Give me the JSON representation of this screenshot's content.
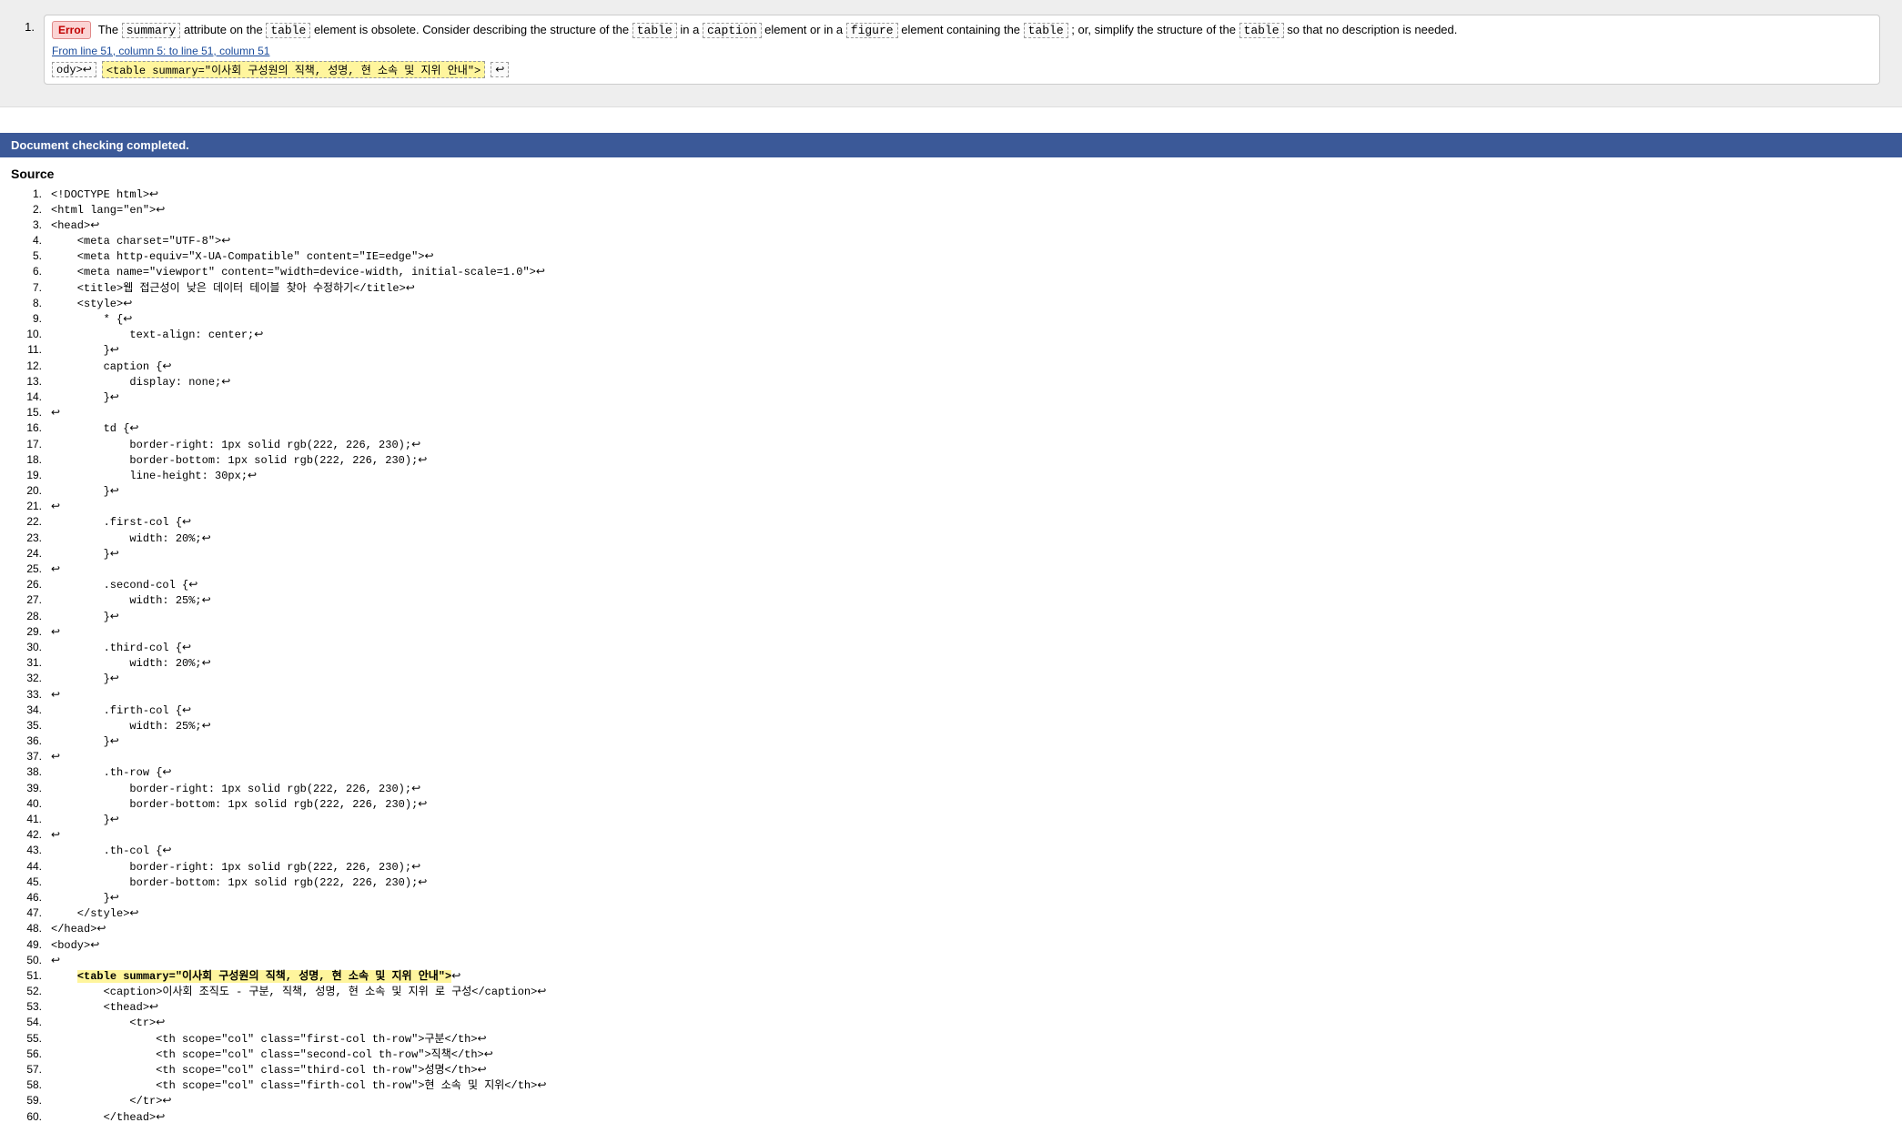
{
  "error": {
    "number": "1.",
    "badge": "Error",
    "msg_prefix": "The ",
    "code1": "summary",
    "msg_mid1": " attribute on the ",
    "code2": "table",
    "msg_mid2": " element is obsolete. Consider describing the structure of the ",
    "code3": "table",
    "msg_mid3": " in a ",
    "code4": "caption",
    "msg_mid4": " element or in a ",
    "code5": "figure",
    "msg_mid5": " element containing the ",
    "code6": "table",
    "msg_mid6": "; or, simplify the structure of the ",
    "code7": "table",
    "msg_suffix": " so that no description is needed.",
    "location_link": "From line 51, column 5: to line 51, column 51",
    "snippet_left": "ody>↩    ",
    "snippet_hl": "<table summary=\"이사회 구성원의 직책, 성명, 현 소속 및 지위 안내\">",
    "snippet_right": "↩  "
  },
  "completed": "Document checking completed.",
  "source_heading": "Source",
  "source": [
    {
      "n": "1.",
      "t": "<!DOCTYPE html>↩"
    },
    {
      "n": "2.",
      "t": "<html lang=\"en\">↩"
    },
    {
      "n": "3.",
      "t": "<head>↩"
    },
    {
      "n": "4.",
      "t": "    <meta charset=\"UTF-8\">↩"
    },
    {
      "n": "5.",
      "t": "    <meta http-equiv=\"X-UA-Compatible\" content=\"IE=edge\">↩"
    },
    {
      "n": "6.",
      "t": "    <meta name=\"viewport\" content=\"width=device-width, initial-scale=1.0\">↩"
    },
    {
      "n": "7.",
      "t": "    <title>웹 접근성이 낮은 데이터 테이블 찾아 수정하기</title>↩"
    },
    {
      "n": "8.",
      "t": "    <style>↩"
    },
    {
      "n": "9.",
      "t": "        * {↩"
    },
    {
      "n": "10.",
      "t": "            text-align: center;↩"
    },
    {
      "n": "11.",
      "t": "        }↩"
    },
    {
      "n": "12.",
      "t": "        caption {↩"
    },
    {
      "n": "13.",
      "t": "            display: none;↩"
    },
    {
      "n": "14.",
      "t": "        }↩"
    },
    {
      "n": "15.",
      "t": "↩"
    },
    {
      "n": "16.",
      "t": "        td {↩"
    },
    {
      "n": "17.",
      "t": "            border-right: 1px solid rgb(222, 226, 230);↩"
    },
    {
      "n": "18.",
      "t": "            border-bottom: 1px solid rgb(222, 226, 230);↩"
    },
    {
      "n": "19.",
      "t": "            line-height: 30px;↩"
    },
    {
      "n": "20.",
      "t": "        }↩"
    },
    {
      "n": "21.",
      "t": "↩"
    },
    {
      "n": "22.",
      "t": "        .first-col {↩"
    },
    {
      "n": "23.",
      "t": "            width: 20%;↩"
    },
    {
      "n": "24.",
      "t": "        }↩"
    },
    {
      "n": "25.",
      "t": "↩"
    },
    {
      "n": "26.",
      "t": "        .second-col {↩"
    },
    {
      "n": "27.",
      "t": "            width: 25%;↩"
    },
    {
      "n": "28.",
      "t": "        }↩"
    },
    {
      "n": "29.",
      "t": "↩"
    },
    {
      "n": "30.",
      "t": "        .third-col {↩"
    },
    {
      "n": "31.",
      "t": "            width: 20%;↩"
    },
    {
      "n": "32.",
      "t": "        }↩"
    },
    {
      "n": "33.",
      "t": "↩"
    },
    {
      "n": "34.",
      "t": "        .firth-col {↩"
    },
    {
      "n": "35.",
      "t": "            width: 25%;↩"
    },
    {
      "n": "36.",
      "t": "        }↩"
    },
    {
      "n": "37.",
      "t": "↩"
    },
    {
      "n": "38.",
      "t": "        .th-row {↩"
    },
    {
      "n": "39.",
      "t": "            border-right: 1px solid rgb(222, 226, 230);↩"
    },
    {
      "n": "40.",
      "t": "            border-bottom: 1px solid rgb(222, 226, 230);↩"
    },
    {
      "n": "41.",
      "t": "        }↩"
    },
    {
      "n": "42.",
      "t": "↩"
    },
    {
      "n": "43.",
      "t": "        .th-col {↩"
    },
    {
      "n": "44.",
      "t": "            border-right: 1px solid rgb(222, 226, 230);↩"
    },
    {
      "n": "45.",
      "t": "            border-bottom: 1px solid rgb(222, 226, 230);↩"
    },
    {
      "n": "46.",
      "t": "        }↩"
    },
    {
      "n": "47.",
      "t": "    </style>↩"
    },
    {
      "n": "48.",
      "t": "</head>↩"
    },
    {
      "n": "49.",
      "t": "<body>↩"
    },
    {
      "n": "50.",
      "t": "↩"
    },
    {
      "n": "51.",
      "t": "    ",
      "hl": "<table summary=\"이사회 구성원의 직책, 성명, 현 소속 및 지위 안내\">",
      "hlr": "↩"
    },
    {
      "n": "52.",
      "t": "        <caption>이사회 조직도 - 구분, 직책, 성명, 현 소속 및 지위 로 구성</caption>↩"
    },
    {
      "n": "53.",
      "t": "        <thead>↩"
    },
    {
      "n": "54.",
      "t": "            <tr>↩"
    },
    {
      "n": "55.",
      "t": "                <th scope=\"col\" class=\"first-col th-row\">구분</th>↩"
    },
    {
      "n": "56.",
      "t": "                <th scope=\"col\" class=\"second-col th-row\">직책</th>↩"
    },
    {
      "n": "57.",
      "t": "                <th scope=\"col\" class=\"third-col th-row\">성명</th>↩"
    },
    {
      "n": "58.",
      "t": "                <th scope=\"col\" class=\"firth-col th-row\">현 소속 및 지위</th>↩"
    },
    {
      "n": "59.",
      "t": "            </tr>↩"
    },
    {
      "n": "60.",
      "t": "        </thead>↩"
    }
  ]
}
